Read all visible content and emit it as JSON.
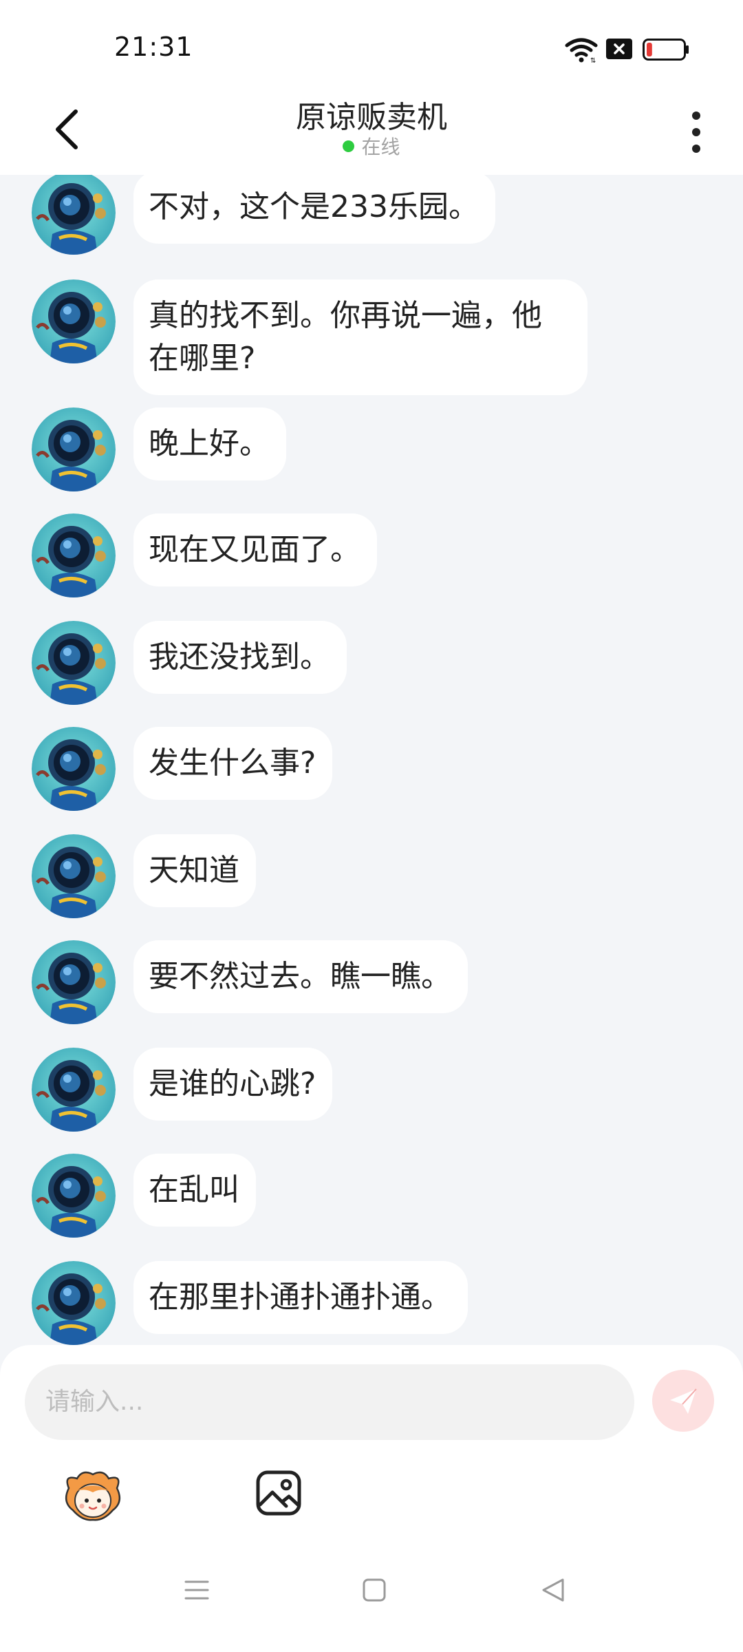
{
  "status_bar": {
    "time": "21:31",
    "battery_level": 0.15,
    "battery_color": "#e53935"
  },
  "header": {
    "title": "原谅贩卖机",
    "status": "在线",
    "status_color": "#2ecc40"
  },
  "messages": [
    {
      "text": "不对，这个是233乐园。"
    },
    {
      "text": "真的找不到。你再说一遍，他在哪里?"
    },
    {
      "text": "晚上好。"
    },
    {
      "text": "现在又见面了。"
    },
    {
      "text": "我还没找到。"
    },
    {
      "text": "发生什么事?"
    },
    {
      "text": "天知道"
    },
    {
      "text": "要不然过去。瞧一瞧。"
    },
    {
      "text": "是谁的心跳?"
    },
    {
      "text": "在乱叫"
    },
    {
      "text": "在那里扑通扑通扑通。"
    }
  ],
  "input": {
    "placeholder": "请输入..."
  },
  "toolbar": {
    "emoji_icon": "mascot-face-icon",
    "image_icon": "gallery-icon"
  },
  "nav": {
    "menu_icon": "menu-icon",
    "home_icon": "home-icon",
    "back_icon": "back-triangle-icon"
  },
  "colors": {
    "accent_send": "#f26b6b",
    "bubble": "#ffffff",
    "background": "#f3f5f8"
  }
}
